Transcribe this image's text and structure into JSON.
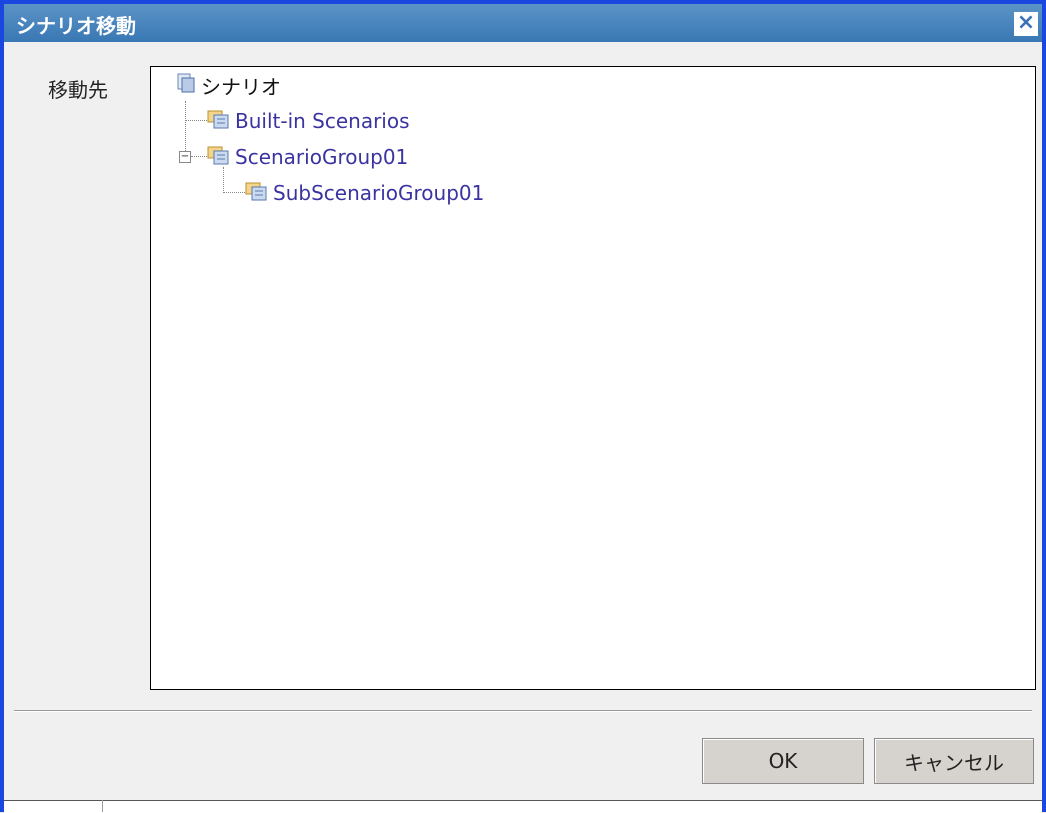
{
  "dialog": {
    "title": "シナリオ移動",
    "close_label": "×"
  },
  "form": {
    "destination_label": "移動先"
  },
  "tree": {
    "root_label": "シナリオ",
    "items": [
      {
        "label": "Built-in Scenarios"
      },
      {
        "label": "ScenarioGroup01",
        "expanded": true
      },
      {
        "label": "SubScenarioGroup01"
      }
    ]
  },
  "buttons": {
    "ok_label": "OK",
    "cancel_label": "キャンセル"
  },
  "colors": {
    "title_bar": "#3978b4",
    "window_border": "#1a47e0",
    "node_text": "#3a33a0"
  }
}
